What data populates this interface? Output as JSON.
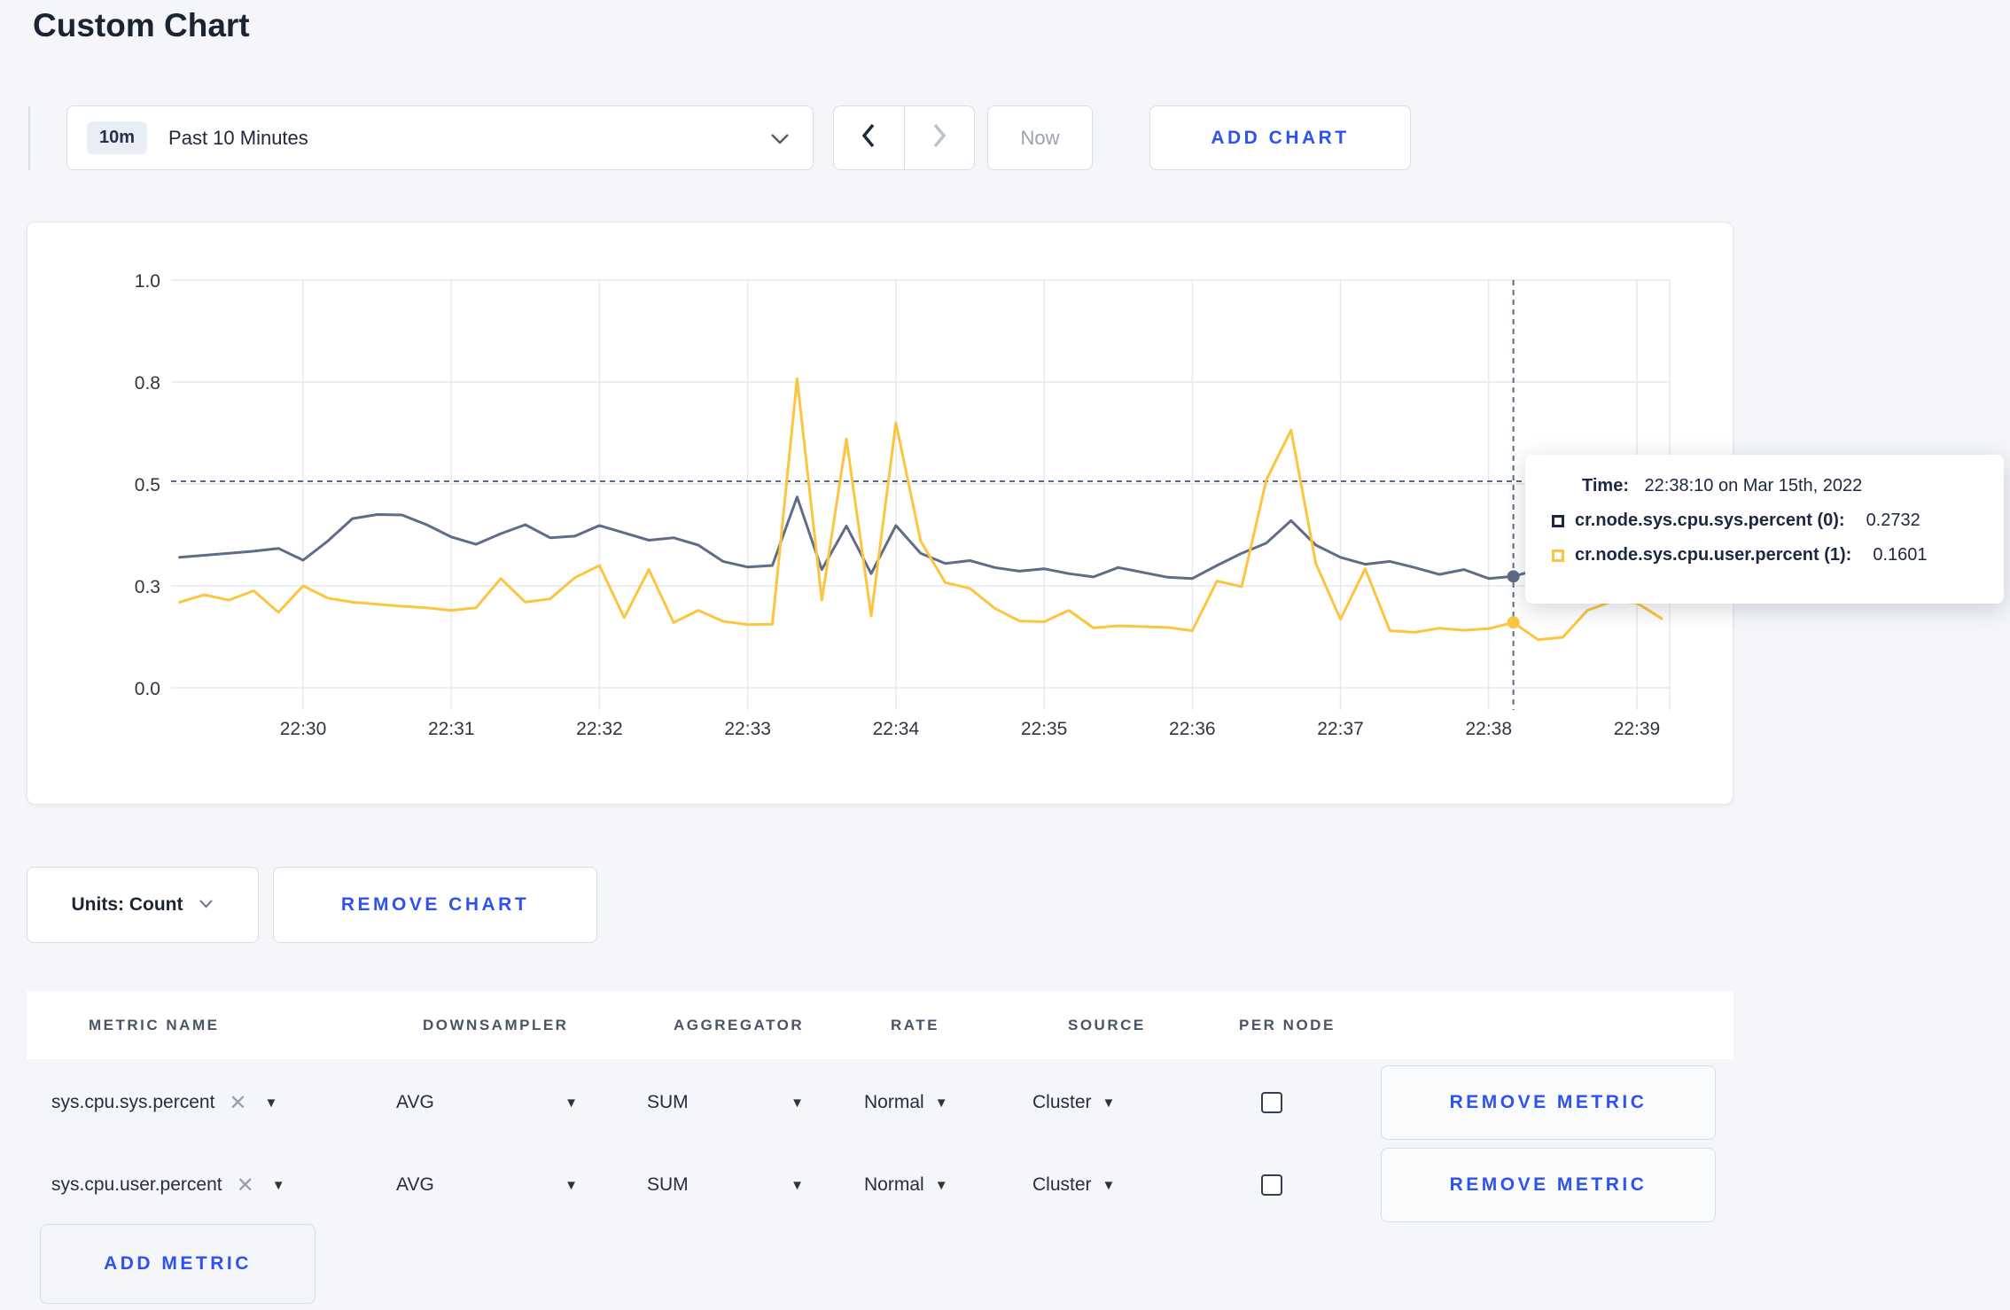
{
  "theme": {
    "page-bg": "#f4f6fa",
    "accent": "#2e52ef",
    "navy": "#1c2741",
    "series-sys": "#5f6c87",
    "series-user": "#fdc53f"
  },
  "page": {
    "title": "Custom Chart"
  },
  "toolbar": {
    "time_range": {
      "badge": "10m",
      "label": "Past 10 Minutes"
    },
    "now_label": "Now",
    "add_chart_label": "ADD CHART"
  },
  "chart_data": {
    "type": "line",
    "title": "",
    "x_start": "22:29:10",
    "x_interval_seconds": 10,
    "x_ticks": [
      {
        "label": "22:30",
        "index": 5
      },
      {
        "label": "22:31",
        "index": 11
      },
      {
        "label": "22:32",
        "index": 17
      },
      {
        "label": "22:33",
        "index": 23
      },
      {
        "label": "22:34",
        "index": 29
      },
      {
        "label": "22:35",
        "index": 35
      },
      {
        "label": "22:36",
        "index": 41
      },
      {
        "label": "22:37",
        "index": 47
      },
      {
        "label": "22:38",
        "index": 53
      },
      {
        "label": "22:39",
        "index": 59
      }
    ],
    "y_ticks": [
      {
        "label": "0.0",
        "value": 0
      },
      {
        "label": "0.3",
        "value": 0.25
      },
      {
        "label": "0.5",
        "value": 0.5
      },
      {
        "label": "0.8",
        "value": 0.75
      },
      {
        "label": "1.0",
        "value": 1
      }
    ],
    "ylim": [
      0,
      1
    ],
    "grid": true,
    "legend_position": "none",
    "series": [
      {
        "name": "cr.node.sys.cpu.sys.percent",
        "color": "#5f6c87",
        "values": [
          0.32,
          0.325,
          0.33,
          0.335,
          0.342,
          0.313,
          0.36,
          0.415,
          0.425,
          0.424,
          0.4,
          0.37,
          0.352,
          0.378,
          0.4,
          0.368,
          0.372,
          0.398,
          0.38,
          0.362,
          0.368,
          0.35,
          0.31,
          0.296,
          0.3,
          0.468,
          0.29,
          0.397,
          0.28,
          0.398,
          0.33,
          0.305,
          0.312,
          0.295,
          0.286,
          0.292,
          0.28,
          0.272,
          0.295,
          0.283,
          0.271,
          0.268,
          0.3,
          0.33,
          0.355,
          0.41,
          0.35,
          0.32,
          0.303,
          0.31,
          0.295,
          0.278,
          0.29,
          0.268,
          0.2732,
          0.29,
          0.302,
          0.308,
          0.3,
          0.305,
          0.31
        ]
      },
      {
        "name": "cr.node.sys.cpu.user.percent",
        "color": "#fdc53f",
        "values": [
          0.21,
          0.228,
          0.215,
          0.238,
          0.185,
          0.25,
          0.22,
          0.21,
          0.205,
          0.2,
          0.196,
          0.19,
          0.196,
          0.268,
          0.21,
          0.218,
          0.27,
          0.3,
          0.172,
          0.29,
          0.16,
          0.19,
          0.163,
          0.155,
          0.156,
          0.758,
          0.215,
          0.61,
          0.176,
          0.65,
          0.36,
          0.258,
          0.244,
          0.195,
          0.164,
          0.162,
          0.19,
          0.147,
          0.152,
          0.15,
          0.148,
          0.14,
          0.262,
          0.248,
          0.51,
          0.632,
          0.305,
          0.168,
          0.292,
          0.14,
          0.136,
          0.146,
          0.141,
          0.145,
          0.1601,
          0.118,
          0.124,
          0.19,
          0.212,
          0.208,
          0.17
        ]
      }
    ],
    "crosshair": {
      "index": 54,
      "time": "22:38:10",
      "guide_value": 0.5065,
      "values": [
        0.2732,
        0.1601
      ]
    }
  },
  "tooltip": {
    "time_label": "Time:",
    "time_value": "22:38:10 on Mar 15th, 2022",
    "rows": [
      {
        "label": "cr.node.sys.cpu.sys.percent (0):",
        "value": "0.2732",
        "color": "#1c2741"
      },
      {
        "label": "cr.node.sys.cpu.user.percent (1):",
        "value": "0.1601",
        "color": "#fdc53f"
      }
    ]
  },
  "chart_controls": {
    "units_label": "Units: Count",
    "remove_chart_label": "REMOVE CHART"
  },
  "metrics_table": {
    "headers": [
      "METRIC NAME",
      "DOWNSAMPLER",
      "AGGREGATOR",
      "RATE",
      "SOURCE",
      "PER NODE"
    ],
    "rows": [
      {
        "metric": "sys.cpu.sys.percent",
        "downsampler": "AVG",
        "aggregator": "SUM",
        "rate": "Normal",
        "source": "Cluster",
        "per_node": false,
        "remove_label": "REMOVE METRIC"
      },
      {
        "metric": "sys.cpu.user.percent",
        "downsampler": "AVG",
        "aggregator": "SUM",
        "rate": "Normal",
        "source": "Cluster",
        "per_node": false,
        "remove_label": "REMOVE METRIC"
      }
    ],
    "add_metric_label": "ADD METRIC"
  }
}
